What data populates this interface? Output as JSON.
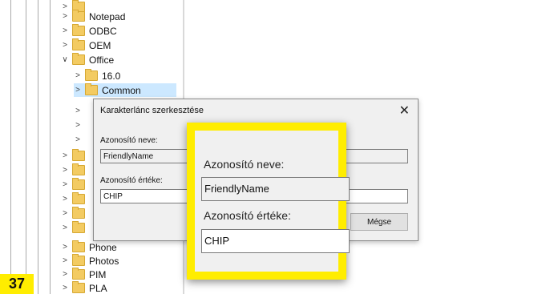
{
  "tree": {
    "items": [
      {
        "label": "Notepad"
      },
      {
        "label": "ODBC"
      },
      {
        "label": "OEM"
      },
      {
        "label": "Office"
      },
      {
        "label": "16.0"
      },
      {
        "label": "Common"
      },
      {
        "label": "Phone"
      },
      {
        "label": "Photos"
      },
      {
        "label": "PIM"
      },
      {
        "label": "PLA"
      }
    ]
  },
  "dialog": {
    "title": "Karakterlánc szerkesztése",
    "name_label": "Azonosító neve:",
    "name_value": "FriendlyName",
    "value_label": "Azonosító értéke:",
    "value_value": "CHIP",
    "cancel_label": "Mégse"
  },
  "zoom": {
    "name_label": "Azonosító neve:",
    "name_value": "FriendlyName",
    "value_label": "Azonosító értéke:",
    "value_value": "CHIP"
  },
  "badge": {
    "number": "37"
  },
  "colors": {
    "highlight": "#ffed00",
    "folder": "#f3cb62",
    "selection": "#cce8ff"
  }
}
